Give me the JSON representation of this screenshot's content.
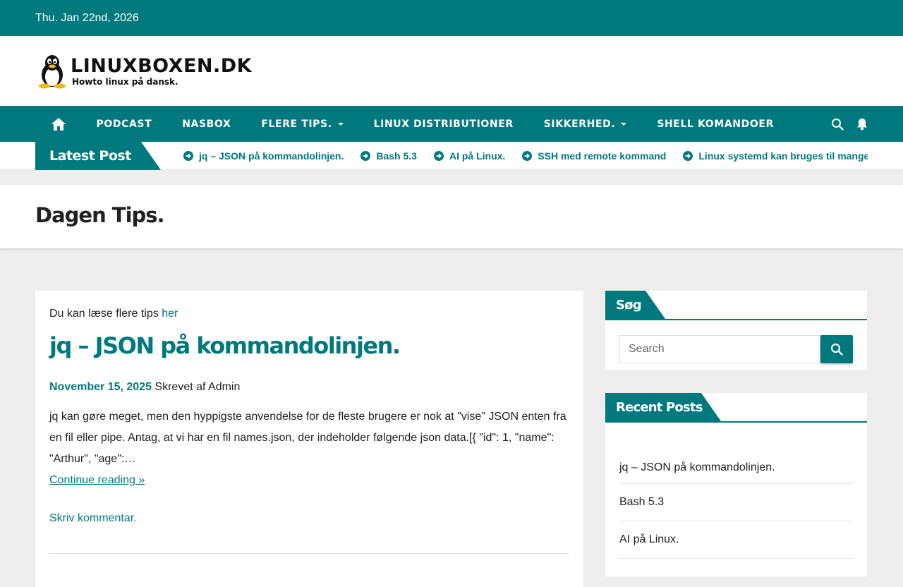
{
  "topbar": {
    "date": "Thu. Jan 22nd, 2026"
  },
  "brand": {
    "title": "LINUXBOXEN.DK",
    "tagline": "Howto linux på dansk."
  },
  "nav": {
    "items": [
      {
        "label": "PODCAST",
        "dropdown": false
      },
      {
        "label": "NASBOX",
        "dropdown": false
      },
      {
        "label": "FLERE TIPS.",
        "dropdown": true
      },
      {
        "label": "LINUX DISTRIBUTIONER",
        "dropdown": false
      },
      {
        "label": "SIKKERHED.",
        "dropdown": true
      },
      {
        "label": "SHELL KOMANDOER",
        "dropdown": false
      }
    ],
    "icons": [
      "home-icon",
      "search-icon",
      "bell-icon"
    ]
  },
  "ticker": {
    "label": "Latest Post",
    "items": [
      "jq – JSON på kommandolinjen.",
      "Bash 5.3",
      "AI på Linux.",
      "SSH med remote kommand",
      "Linux systemd kan bruges til mange"
    ]
  },
  "page": {
    "title": "Dagen Tips."
  },
  "post": {
    "intro_text": "Du kan læse flere tips ",
    "intro_link": "her",
    "title": "jq – JSON på kommandolinjen.",
    "date": "November 15, 2025",
    "author_text": " Skrevet af Admin",
    "excerpt": "jq kan gøre meget, men den hyppigste anvendelse for de fleste brugere er nok at \"vise\" JSON enten fra en fil eller pipe. Antag, at vi har en fil names.json, der indeholder følgende json data.[{ \"id\": 1, \"name\": \"Arthur\", \"age\":…",
    "read_more": "Continue reading »",
    "comment": "Skriv kommentar."
  },
  "sidebar": {
    "search": {
      "title": "Søg",
      "placeholder": "Search"
    },
    "recent": {
      "title": "Recent Posts",
      "items": [
        "jq – JSON på kommandolinjen.",
        "Bash 5.3",
        "AI på Linux."
      ]
    }
  },
  "colors": {
    "accent": "#00797e",
    "background": "#eeeeee"
  }
}
